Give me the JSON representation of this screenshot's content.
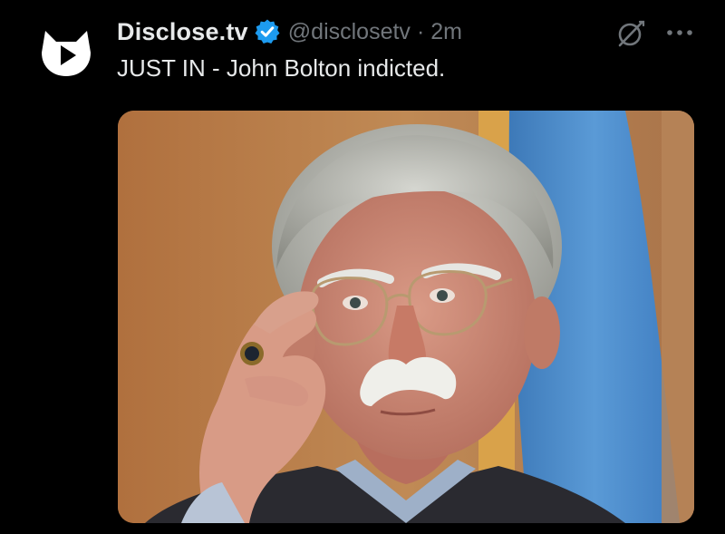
{
  "tweet": {
    "display_name": "Disclose.tv",
    "handle": "@disclosetv",
    "separator": "·",
    "time": "2m",
    "text": "JUST IN - John Bolton indicted."
  },
  "icons": {
    "avatar": "disclose-tv-logo",
    "verified": "verified-badge-icon",
    "grok": "grok-icon",
    "more": "more-options-icon"
  },
  "colors": {
    "background": "#000000",
    "primary_text": "#e7e9ea",
    "secondary_text": "#71767b",
    "verified_badge": "#1d9bf0"
  },
  "media": {
    "type": "photo"
  }
}
